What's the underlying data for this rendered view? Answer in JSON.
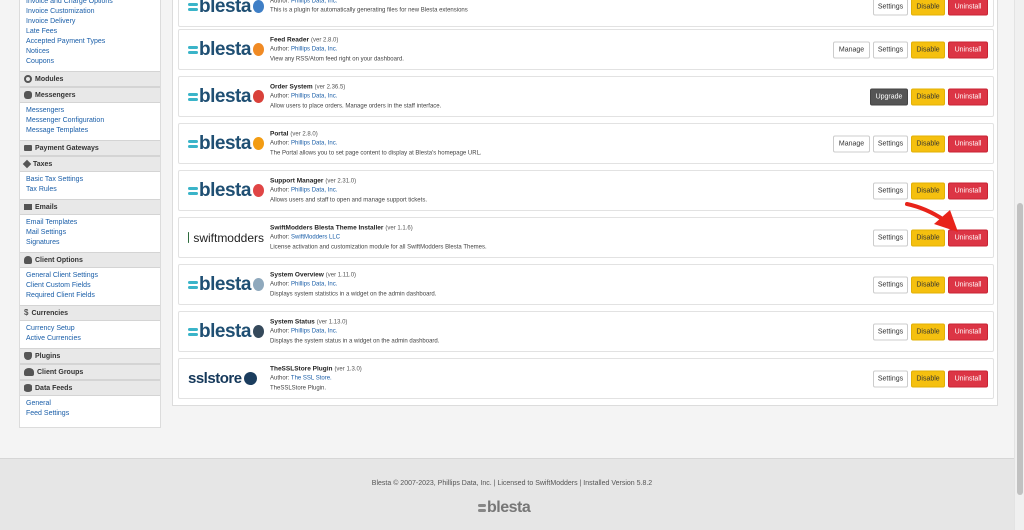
{
  "sidebar": {
    "groups": [
      {
        "header": "",
        "links": [
          "Invoice and Charge Options",
          "Invoice Customization",
          "Invoice Delivery",
          "Late Fees",
          "Accepted Payment Types",
          "Notices",
          "Coupons"
        ]
      },
      {
        "header": "Modules",
        "icon": "gear-icon",
        "links": []
      },
      {
        "header": "Messengers",
        "icon": "chat-bubble-icon",
        "links": [
          "Messengers",
          "Messenger Configuration",
          "Message Templates"
        ]
      },
      {
        "header": "Payment Gateways",
        "icon": "credit-card-icon",
        "links": []
      },
      {
        "header": "Taxes",
        "icon": "tag-icon",
        "links": [
          "Basic Tax Settings",
          "Tax Rules"
        ]
      },
      {
        "header": "Emails",
        "icon": "envelope-icon",
        "links": [
          "Email Templates",
          "Mail Settings",
          "Signatures"
        ]
      },
      {
        "header": "Client Options",
        "icon": "user-icon",
        "links": [
          "General Client Settings",
          "Client Custom Fields",
          "Required Client Fields"
        ]
      },
      {
        "header": "Currencies",
        "icon": "dollar-icon",
        "links": [
          "Currency Setup",
          "Active Currencies"
        ]
      },
      {
        "header": "Plugins",
        "icon": "plug-icon",
        "links": []
      },
      {
        "header": "Client Groups",
        "icon": "users-icon",
        "links": []
      },
      {
        "header": "Data Feeds",
        "icon": "database-icon",
        "links": [
          "General",
          "Feed Settings"
        ]
      }
    ]
  },
  "plugins": [
    {
      "logo": "blesta",
      "badge": "#3f7fc6",
      "name": "",
      "version": "",
      "author_label": "Author:",
      "author": "Phillips Data, Inc.",
      "description": "This is a plugin for automatically generating files for new Blesta extensions",
      "buttons": [
        "Settings",
        "Disable",
        "Uninstall"
      ]
    },
    {
      "logo": "blesta",
      "badge": "#f08a24",
      "name": "Feed Reader",
      "version": "(ver 2.8.0)",
      "author_label": "Author:",
      "author": "Phillips Data, Inc.",
      "description": "View any RSS/Atom feed right on your dashboard.",
      "buttons": [
        "Manage",
        "Settings",
        "Disable",
        "Uninstall"
      ]
    },
    {
      "logo": "blesta",
      "badge": "#d9413a",
      "name": "Order System",
      "version": "(ver 2.36.5)",
      "author_label": "Author:",
      "author": "Phillips Data, Inc.",
      "description": "Allow users to place orders. Manage orders in the staff interface.",
      "buttons": [
        "Upgrade",
        "Disable",
        "Uninstall"
      ]
    },
    {
      "logo": "blesta",
      "badge": "#f39c12",
      "name": "Portal",
      "version": "(ver 2.8.0)",
      "author_label": "Author:",
      "author": "Phillips Data, Inc.",
      "description": "The Portal allows you to set page content to display at Blesta's homepage URL.",
      "buttons": [
        "Manage",
        "Settings",
        "Disable",
        "Uninstall"
      ]
    },
    {
      "logo": "blesta",
      "badge": "#e04545",
      "name": "Support Manager",
      "version": "(ver 2.31.0)",
      "author_label": "Author:",
      "author": "Phillips Data, Inc.",
      "description": "Allows users and staff to open and manage support tickets.",
      "buttons": [
        "Settings",
        "Disable",
        "Uninstall"
      ]
    },
    {
      "logo": "swiftmodders",
      "badge": "",
      "name": "SwiftModders Blesta Theme Installer",
      "version": "(ver 1.1.6)",
      "author_label": "Author:",
      "author": "SwiftModders LLC",
      "description": "License activation and customization module for all SwiftModders Blesta Themes.",
      "buttons": [
        "Settings",
        "Disable",
        "Uninstall"
      ]
    },
    {
      "logo": "blesta",
      "badge": "#8fa9bd",
      "name": "System Overview",
      "version": "(ver 1.11.0)",
      "author_label": "Author:",
      "author": "Phillips Data, Inc.",
      "description": "Displays system statistics in a widget on the admin dashboard.",
      "buttons": [
        "Settings",
        "Disable",
        "Uninstall"
      ]
    },
    {
      "logo": "blesta",
      "badge": "#35495b",
      "name": "System Status",
      "version": "(ver 1.13.0)",
      "author_label": "Author:",
      "author": "Phillips Data, Inc.",
      "description": "Displays the system status in a widget on the admin dashboard.",
      "buttons": [
        "Settings",
        "Disable",
        "Uninstall"
      ]
    },
    {
      "logo": "sslstore",
      "badge": "#1b3d5e",
      "name": "TheSSLStore Plugin",
      "version": "(ver 1.3.0)",
      "author_label": "Author:",
      "author": "The SSL Store.",
      "description": "TheSSLStore Plugin.",
      "buttons": [
        "Settings",
        "Disable",
        "Uninstall"
      ]
    }
  ],
  "logos": {
    "blesta": "blesta",
    "swiftmodders": "swiftmodders",
    "sslstore": "sslstore"
  },
  "footer": {
    "text": "Blesta © 2007-2023, Phillips Data, Inc. | Licensed to SwiftModders | Installed Version 5.8.2",
    "logo": "blesta"
  },
  "colors": {
    "disable": "#f5c00f",
    "uninstall": "#dc3545",
    "upgrade": "#555555",
    "link": "#1a5ea8",
    "arrow": "#e8231a"
  }
}
